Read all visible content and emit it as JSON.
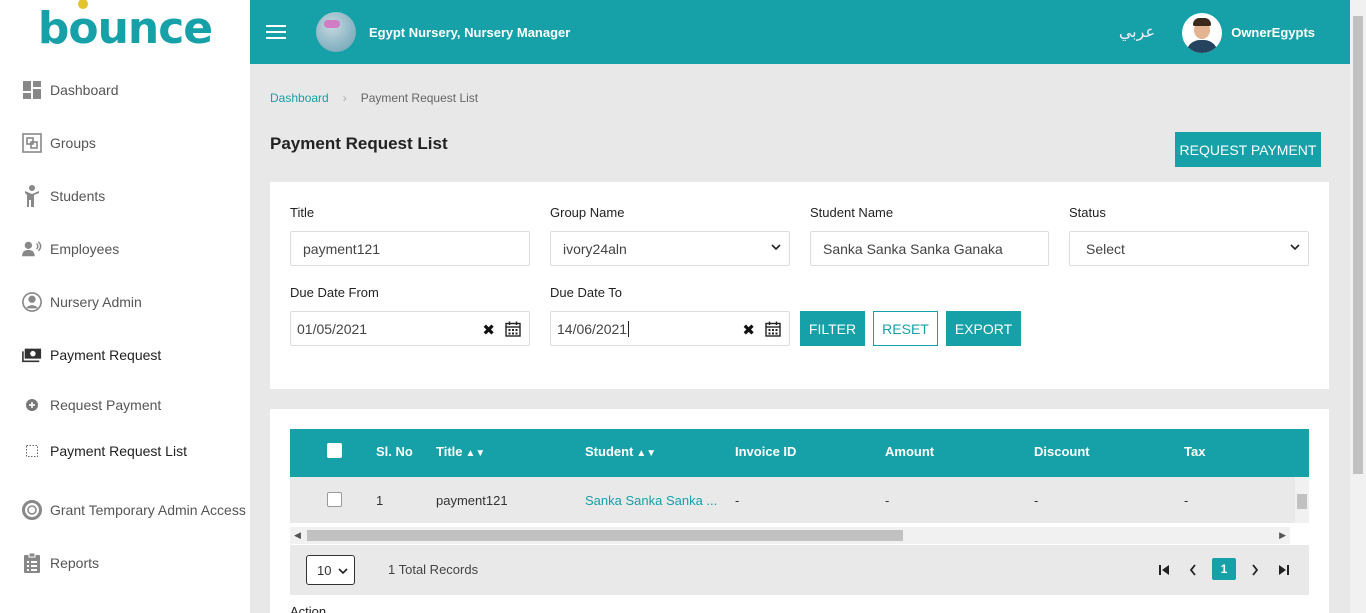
{
  "logo": "bounce",
  "sidebar": {
    "items": [
      {
        "label": "Dashboard",
        "icon": "dashboard-icon"
      },
      {
        "label": "Groups",
        "icon": "groups-icon"
      },
      {
        "label": "Students",
        "icon": "student-icon"
      },
      {
        "label": "Employees",
        "icon": "employees-icon"
      },
      {
        "label": "Nursery Admin",
        "icon": "user-circle-icon"
      },
      {
        "label": "Payment Request",
        "icon": "money-icon"
      },
      {
        "label": "Request Payment",
        "icon": "plus-circle-icon"
      },
      {
        "label": "Payment Request List",
        "icon": "dotted-square-icon"
      },
      {
        "label": "Grant Temporary Admin Access",
        "icon": "lifebuoy-icon"
      },
      {
        "label": "Reports",
        "icon": "clipboard-icon"
      }
    ]
  },
  "header": {
    "title": "Egypt Nursery, Nursery Manager",
    "lang": "عربي",
    "user": "OwnerEgypts"
  },
  "breadcrumb": {
    "home": "Dashboard",
    "current": "Payment Request List"
  },
  "page": {
    "title": "Payment Request List",
    "request_button": "REQUEST PAYMENT"
  },
  "filters": {
    "title_label": "Title",
    "title_value": "payment121",
    "group_label": "Group Name",
    "group_value": "ivory24aln",
    "student_label": "Student Name",
    "student_value": "Sanka Sanka Sanka Ganaka",
    "status_label": "Status",
    "status_value": "Select",
    "from_label": "Due Date From",
    "from_value": "01/05/2021",
    "to_label": "Due Date To",
    "to_value": "14/06/2021",
    "filter_button": "FILTER",
    "reset_button": "RESET",
    "export_button": "EXPORT"
  },
  "table": {
    "columns": [
      "Sl. No",
      "Title",
      "Student",
      "Invoice ID",
      "Amount",
      "Discount",
      "Tax"
    ],
    "rows": [
      {
        "sl": "1",
        "title": "payment121",
        "student": "Sanka Sanka Sanka ...",
        "invoice": "-",
        "amount": "-",
        "discount": "-",
        "tax": "-"
      }
    ],
    "per_page": "10",
    "total": "1 Total Records",
    "current_page": "1",
    "next_section": "Action"
  },
  "colors": {
    "accent": "#16a0a8"
  }
}
